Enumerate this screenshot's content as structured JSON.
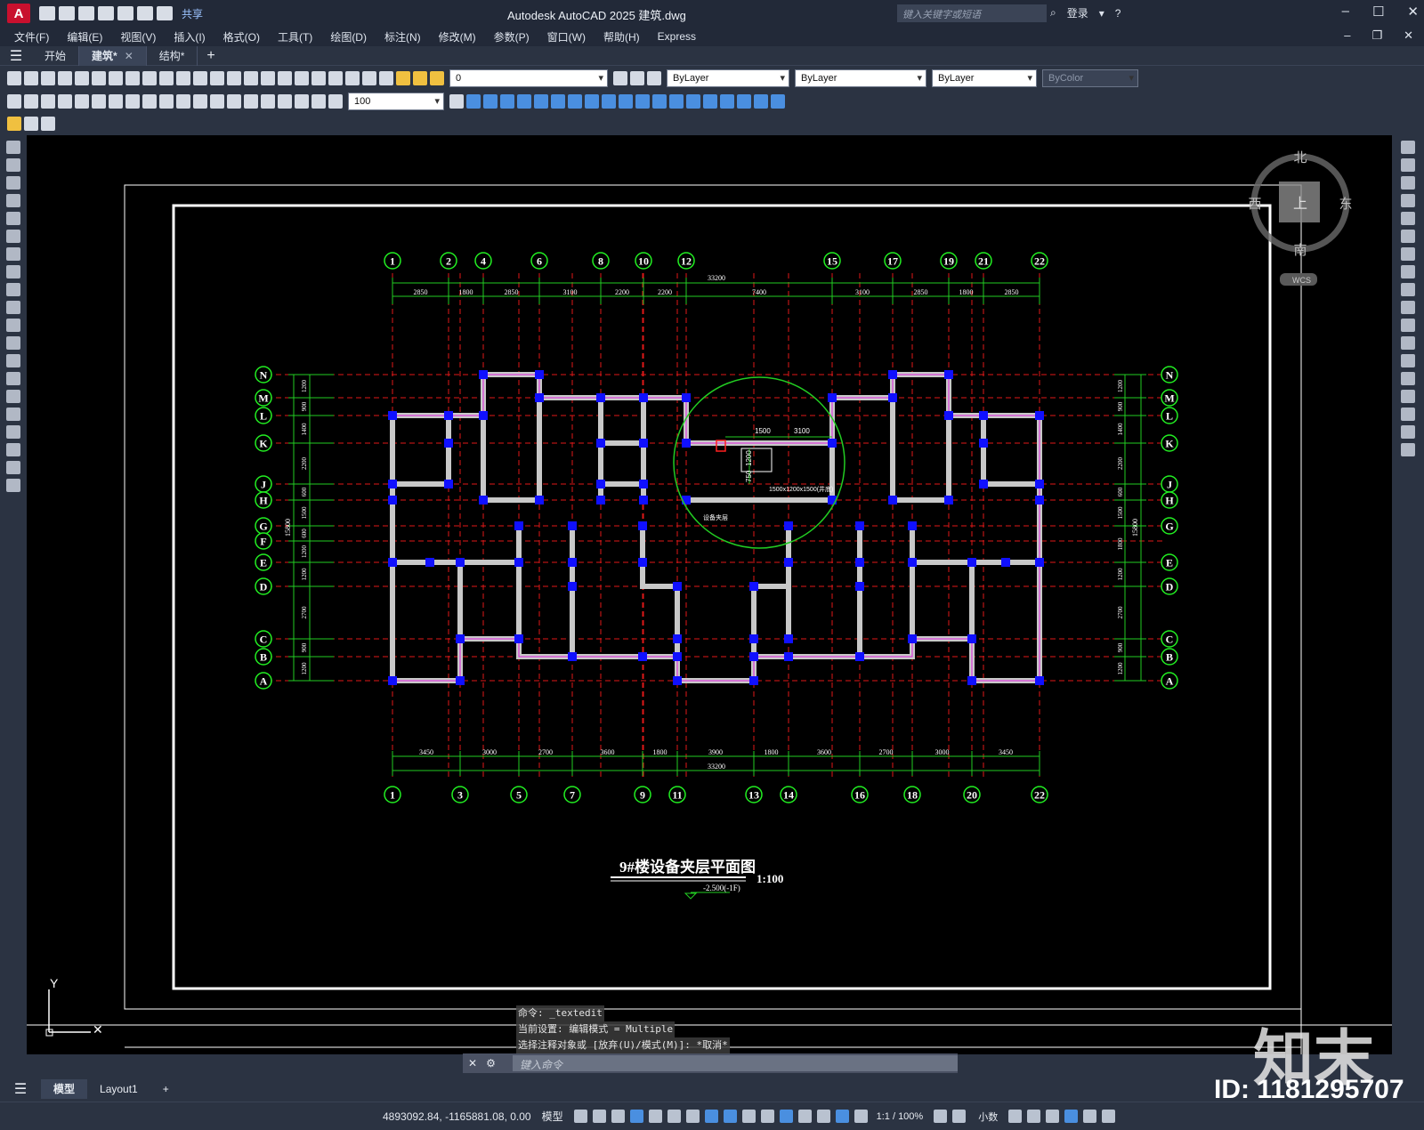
{
  "titlebar": {
    "app_letter": "A",
    "share": "共享",
    "title": "Autodesk AutoCAD 2025    建筑.dwg",
    "search_placeholder": "键入关键字或短语",
    "login": "登录"
  },
  "menu": [
    "文件(F)",
    "编辑(E)",
    "视图(V)",
    "插入(I)",
    "格式(O)",
    "工具(T)",
    "绘图(D)",
    "标注(N)",
    "修改(M)",
    "参数(P)",
    "窗口(W)",
    "帮助(H)",
    "Express"
  ],
  "tabs": [
    {
      "label": "开始",
      "active": false,
      "closable": false
    },
    {
      "label": "建筑*",
      "active": true,
      "closable": true
    },
    {
      "label": "结构*",
      "active": false,
      "closable": false
    }
  ],
  "layer_combo": "0",
  "prop_combos": {
    "color": "ByLayer",
    "linetype": "ByLayer",
    "lineweight": "ByLayer",
    "plotstyle": "ByColor"
  },
  "dim_scale_combo": "100",
  "viewcube": {
    "north": "北",
    "south": "南",
    "east": "东",
    "west": "西",
    "top": "上",
    "wcs": "WCS"
  },
  "drawing": {
    "title": "9#楼设备夹层平面图",
    "scale": "1:100",
    "level": "-2.500(-1F)",
    "top_axes": [
      "1",
      "2",
      "4",
      "6",
      "8",
      "10",
      "12",
      "15",
      "17",
      "19",
      "21",
      "22"
    ],
    "bottom_axes": [
      "1",
      "3",
      "5",
      "7",
      "9",
      "11",
      "13",
      "14",
      "16",
      "18",
      "20",
      "22"
    ],
    "row_axes": [
      "N",
      "M",
      "L",
      "K",
      "J",
      "H",
      "G",
      "F",
      "E",
      "D",
      "C",
      "B",
      "A"
    ],
    "right_row_axes": [
      "N",
      "M",
      "L",
      "K",
      "J",
      "H",
      "G",
      "E",
      "D",
      "C",
      "B",
      "A"
    ],
    "top_total": "33200",
    "top_dims": [
      "2850",
      "1800",
      "2850",
      "3100",
      "2200",
      "2200",
      "7400",
      "3100",
      "2850",
      "1800",
      "2850"
    ],
    "bottom_total": "33200",
    "bottom_dims": [
      "3450",
      "3000",
      "2700",
      "3600",
      "1800",
      "3900",
      "1800",
      "3600",
      "2700",
      "3000",
      "3450"
    ],
    "left_total": "15800",
    "left_dims": [
      "1200",
      "900",
      "1400",
      "2200",
      "600",
      "1500",
      "600",
      "1200",
      "1200",
      "2700",
      "900",
      "1200"
    ],
    "right_total": "15800",
    "right_dims": [
      "1200",
      "900",
      "1400",
      "2200",
      "600",
      "1500",
      "1800",
      "1200",
      "2700",
      "900",
      "1200"
    ],
    "detail_dims": [
      "1500",
      "3100",
      "1200",
      "750"
    ],
    "detail_note": "1500x1200x1500(井底)",
    "detail_label": "设备夹层"
  },
  "ucs": {
    "y": "Y"
  },
  "command": {
    "history": [
      "命令: _textedit",
      "当前设置: 编辑模式 = Multiple",
      "选择注释对象或 [放弃(U)/模式(M)]: *取消*"
    ],
    "placeholder": "键入命令"
  },
  "layout_tabs": [
    {
      "label": "模型",
      "active": true
    },
    {
      "label": "Layout1",
      "active": false
    }
  ],
  "status": {
    "coords": "4893092.84, -1165881.08, 0.00",
    "mode": "模型",
    "scale": "1:1 / 100%",
    "units": "小数"
  },
  "watermark": {
    "logo": "知末",
    "id": "ID: 1181295707"
  }
}
